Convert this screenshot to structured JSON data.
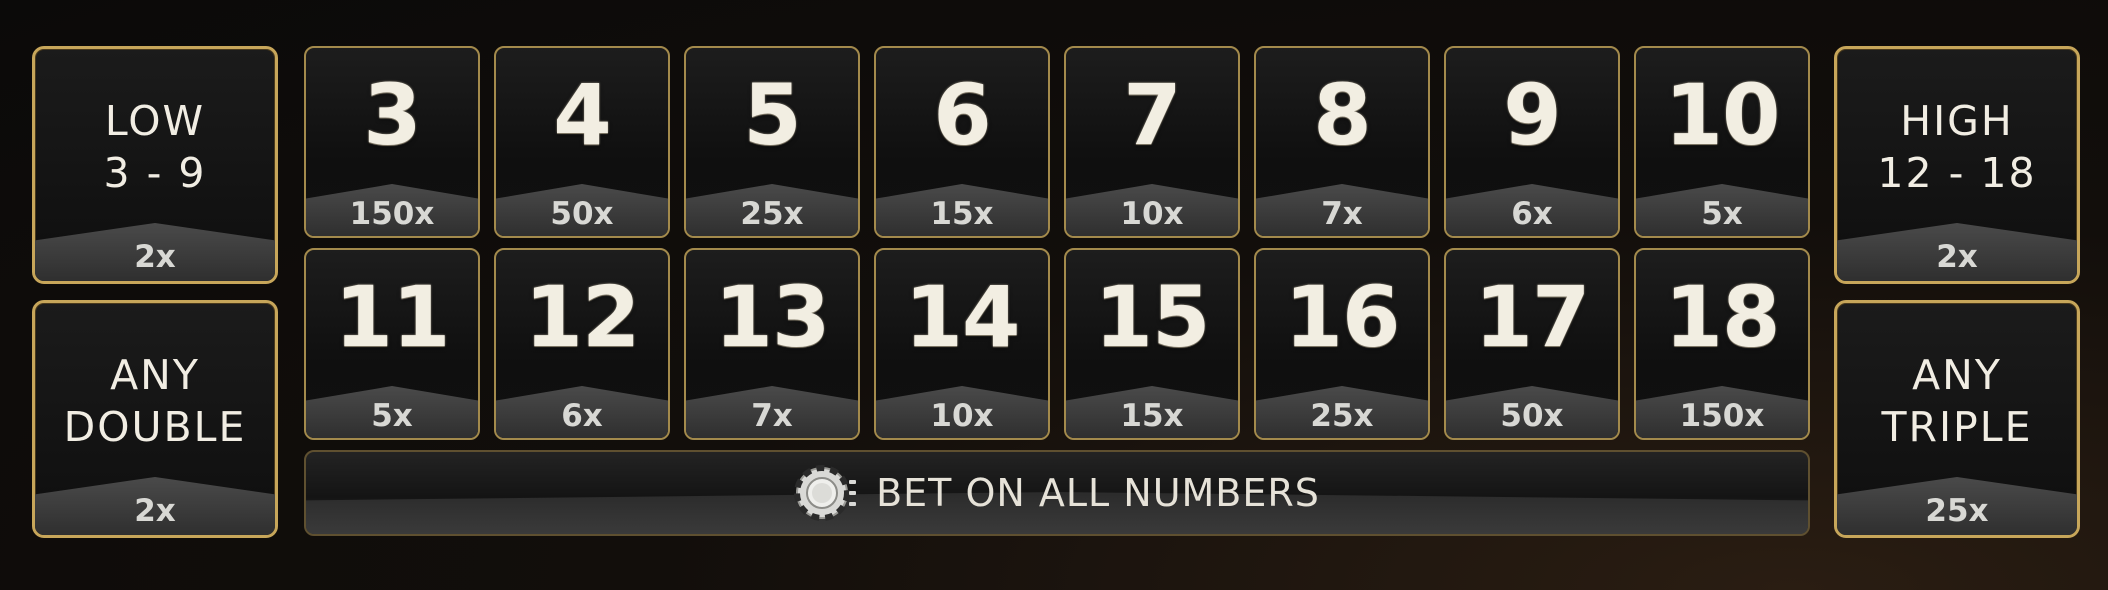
{
  "side_bets": {
    "low": {
      "line1": "LOW",
      "line2": "3 - 9",
      "payout": "2x"
    },
    "any_double": {
      "line1": "ANY",
      "line2": "DOUBLE",
      "payout": "2x"
    },
    "high": {
      "line1": "HIGH",
      "line2": "12 - 18",
      "payout": "2x"
    },
    "any_triple": {
      "line1": "ANY",
      "line2": "TRIPLE",
      "payout": "25x"
    }
  },
  "totals_row1": [
    {
      "number": "3",
      "payout": "150x"
    },
    {
      "number": "4",
      "payout": "50x"
    },
    {
      "number": "5",
      "payout": "25x"
    },
    {
      "number": "6",
      "payout": "15x"
    },
    {
      "number": "7",
      "payout": "10x"
    },
    {
      "number": "8",
      "payout": "7x"
    },
    {
      "number": "9",
      "payout": "6x"
    },
    {
      "number": "10",
      "payout": "5x"
    }
  ],
  "totals_row2": [
    {
      "number": "11",
      "payout": "5x"
    },
    {
      "number": "12",
      "payout": "6x"
    },
    {
      "number": "13",
      "payout": "7x"
    },
    {
      "number": "14",
      "payout": "10x"
    },
    {
      "number": "15",
      "payout": "15x"
    },
    {
      "number": "16",
      "payout": "25x"
    },
    {
      "number": "17",
      "payout": "50x"
    },
    {
      "number": "18",
      "payout": "150x"
    }
  ],
  "bet_all": {
    "label": "BET ON ALL NUMBERS",
    "icon": "chip-icon"
  },
  "colors": {
    "gold_border": "#c7a65a",
    "tile_border": "#a38a4c",
    "number_text": "#f2eee2",
    "payout_text": "#d8d8d4"
  }
}
